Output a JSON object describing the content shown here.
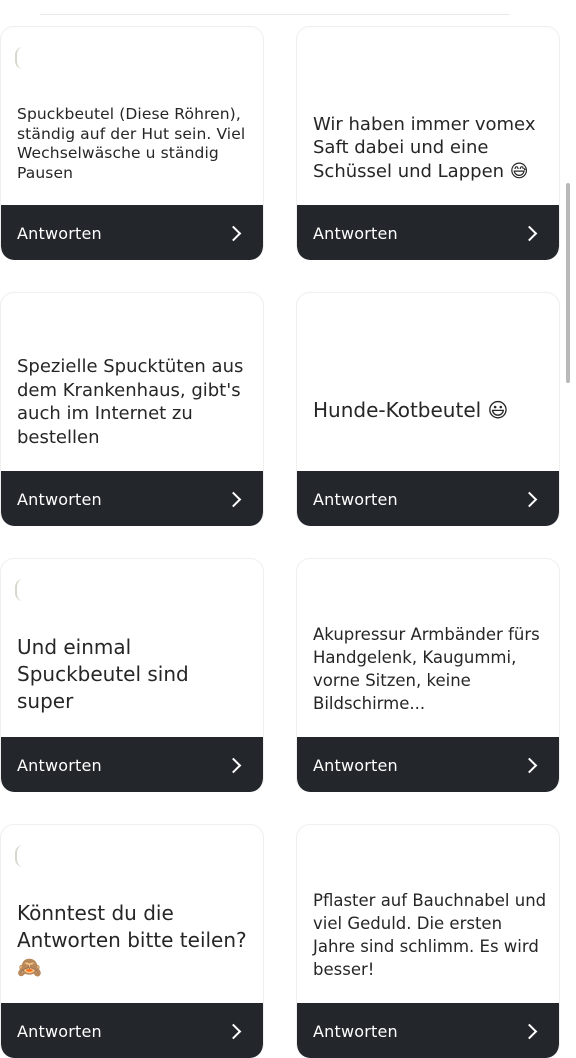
{
  "cards": [
    {
      "text": "Spuckbeutel (Diese Röhren), ständig auf der Hut sein. Viel Wechselwäsche u ständig Pausen",
      "reply": "Antworten"
    },
    {
      "text": "Wir haben immer vomex Saft dabei und eine Schüssel und Lappen 😅",
      "reply": "Antworten"
    },
    {
      "text": "Spezielle Spucktüten aus dem Krankenhaus, gibt's auch im Internet zu bestellen",
      "reply": "Antworten"
    },
    {
      "text": "Hunde-Kotbeutel 😃",
      "reply": "Antworten"
    },
    {
      "text": "Und einmal Spuckbeutel sind super",
      "reply": "Antworten"
    },
    {
      "text": "Akupressur Armbänder fürs Handgelenk, Kaugummi, vorne Sitzen, keine Bildschirme...",
      "reply": "Antworten"
    },
    {
      "text": "Könntest du die Antworten bitte teilen? 🙈",
      "reply": "Antworten"
    },
    {
      "text": "Pflaster auf Bauchnabel und viel Geduld. Die ersten Jahre sind schlimm. Es wird besser!",
      "reply": "Antworten"
    }
  ]
}
